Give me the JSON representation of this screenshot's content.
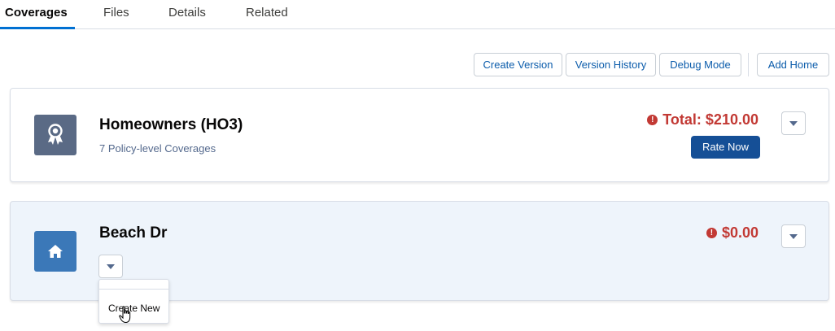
{
  "tabs": [
    {
      "label": "Coverages"
    },
    {
      "label": "Files"
    },
    {
      "label": "Details"
    },
    {
      "label": "Related"
    }
  ],
  "toolbar": {
    "create_version": "Create Version",
    "version_history": "Version History",
    "debug_mode": "Debug Mode",
    "add_home": "Add Home"
  },
  "policy_card": {
    "icon": "award-ribbon-icon",
    "title": "Homeowners (HO3)",
    "subtitle": "7 Policy-level Coverages",
    "total": "Total: $210.00",
    "rate_button": "Rate Now"
  },
  "home_card": {
    "icon": "home-icon",
    "title": "Beach Dr",
    "total": "$0.00",
    "dropdown": {
      "items": [
        {
          "label": "Create New"
        }
      ]
    }
  },
  "colors": {
    "accent": "#0070d2",
    "error": "#c23934",
    "policy_icon_bg": "#5a6a85",
    "home_icon_bg": "#3b78b8",
    "rate_button_bg": "#154f96"
  }
}
